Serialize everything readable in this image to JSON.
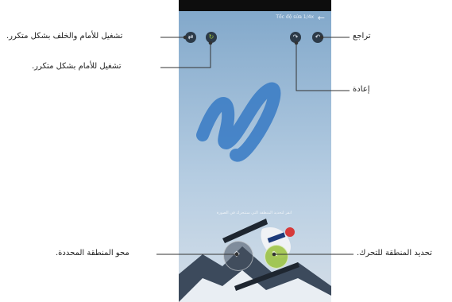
{
  "phone": {
    "topbar_title": "Tốc độ sửa 1/4x",
    "hint_text": "انقر لتحديد المنطقة التي ستتحرك في الصورة"
  },
  "callouts": {
    "playback_loop": "تشغيل للأمام والخلف بشكل متكرر.",
    "forward_loop": "تشغيل للأمام بشكل متكرر.",
    "undo": "تراجع",
    "redo": "إعادة",
    "erase_area": "محو المنطقة المحددة.",
    "select_motion_area": "تحديد المنطقة للتحرك."
  },
  "icons": {
    "back": "back-arrow-icon",
    "playback_loop": "swap-arrows-icon",
    "forward_loop": "forward-loop-icon",
    "undo": "undo-icon",
    "redo": "redo-icon",
    "erase": "eraser-icon",
    "brush": "brush-icon"
  },
  "colors": {
    "brush_stroke": "#3f7fc6",
    "background_top": "#7fa6c9",
    "control_bg": "#2c3a48",
    "callout_line": "#333333",
    "accent": "#9ac23c"
  }
}
